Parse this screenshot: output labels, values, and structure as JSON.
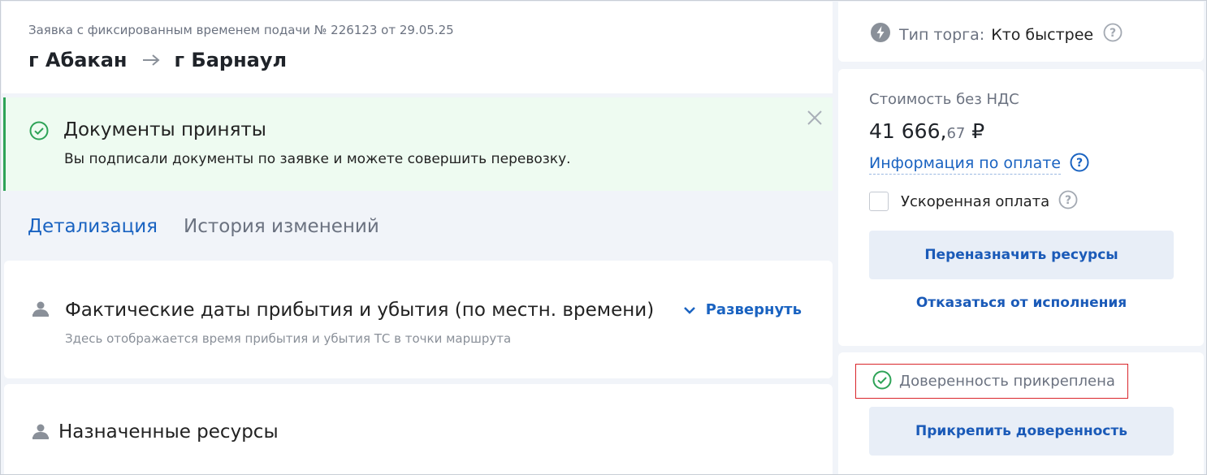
{
  "header": {
    "order_subtitle": "Заявка с фиксированным временем подачи № 226123 от 29.05.25",
    "route_from": "г Абакан",
    "route_to": "г Барнаул"
  },
  "notice": {
    "title": "Документы приняты",
    "text": "Вы подписали документы по заявке и можете совершить перевозку."
  },
  "tabs": [
    {
      "label": "Детализация",
      "active": true
    },
    {
      "label": "История изменений",
      "active": false
    }
  ],
  "sections": {
    "actual_dates": {
      "title": "Фактические даты прибытия и убытия (по местн. времени)",
      "subtitle": "Здесь отображается время прибытия и убытия ТС в точки маршрута",
      "expand_label": "Развернуть"
    },
    "resources": {
      "title": "Назначенные ресурсы"
    }
  },
  "sidebar": {
    "trade_type_label": "Тип торга:",
    "trade_type_value": "Кто быстрее",
    "price_label": "Стоимость без НДС",
    "price_main": "41 666,",
    "price_kop": "67",
    "price_currency": " ₽",
    "payment_info_link": "Информация по оплате",
    "fast_payment_label": "Ускоренная оплата",
    "fast_payment_checked": false,
    "reassign_button": "Переназначить ресурсы",
    "refuse_link": "Отказаться от исполнения",
    "proxy_status": "Доверенность прикреплена",
    "attach_proxy_button": "Прикрепить доверенность"
  },
  "colors": {
    "accent": "#1a63c1",
    "success": "#2ea357",
    "success_bg": "#eefbf1",
    "highlight_border": "#d9252b"
  }
}
